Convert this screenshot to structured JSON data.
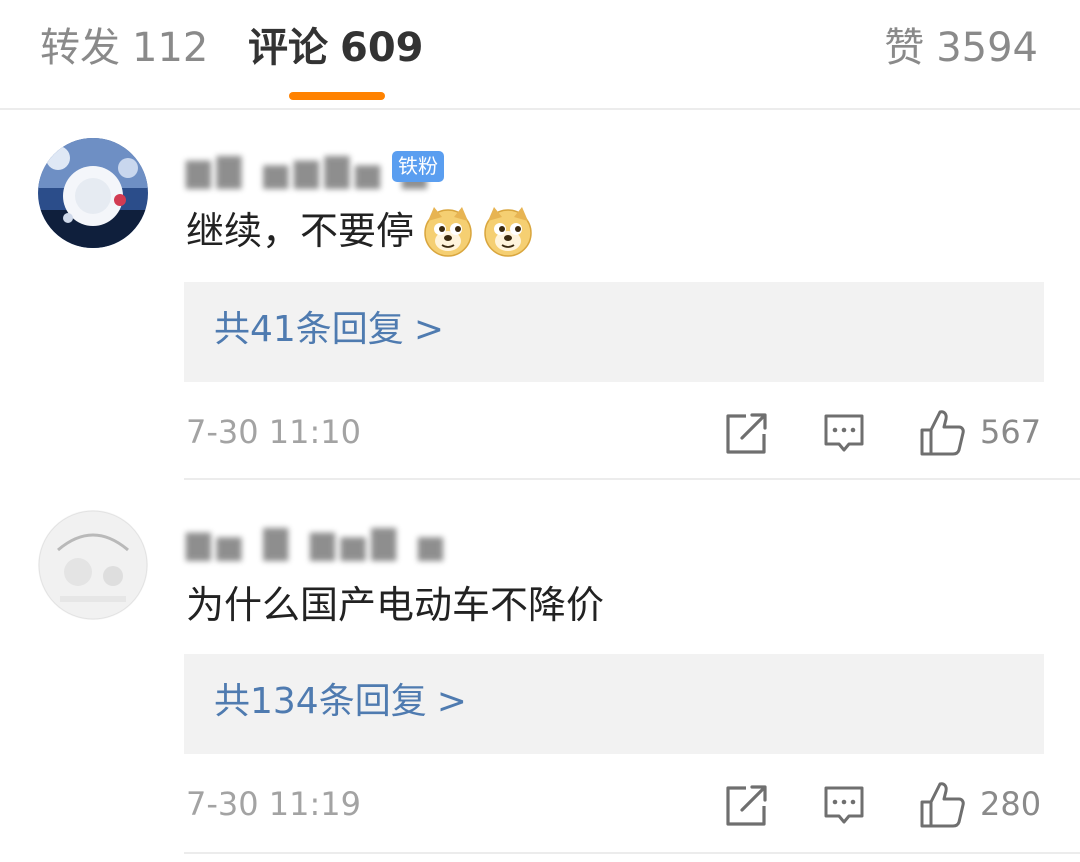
{
  "tabs": {
    "repost": {
      "label": "转发",
      "count": "112"
    },
    "comments": {
      "label": "评论",
      "count": "609"
    },
    "likes": {
      "label": "赞",
      "count": "3594"
    }
  },
  "accent_color": "#ff8200",
  "comments": [
    {
      "badge": "铁粉",
      "text": "继续，不要停",
      "emojis": [
        "doge-emoji",
        "doge-emoji"
      ],
      "reply_link": "共41条回复",
      "reply_chevron": ">",
      "timestamp": "7-30 11:10",
      "like_count": "567"
    },
    {
      "text": "为什么国产电动车不降价",
      "reply_link": "共134条回复",
      "reply_chevron": ">",
      "timestamp": "7-30 11:19",
      "like_count": "280"
    }
  ],
  "icons": {
    "repost": "share-arrow-icon",
    "comment": "comment-bubble-icon",
    "like": "thumbs-up-icon"
  }
}
